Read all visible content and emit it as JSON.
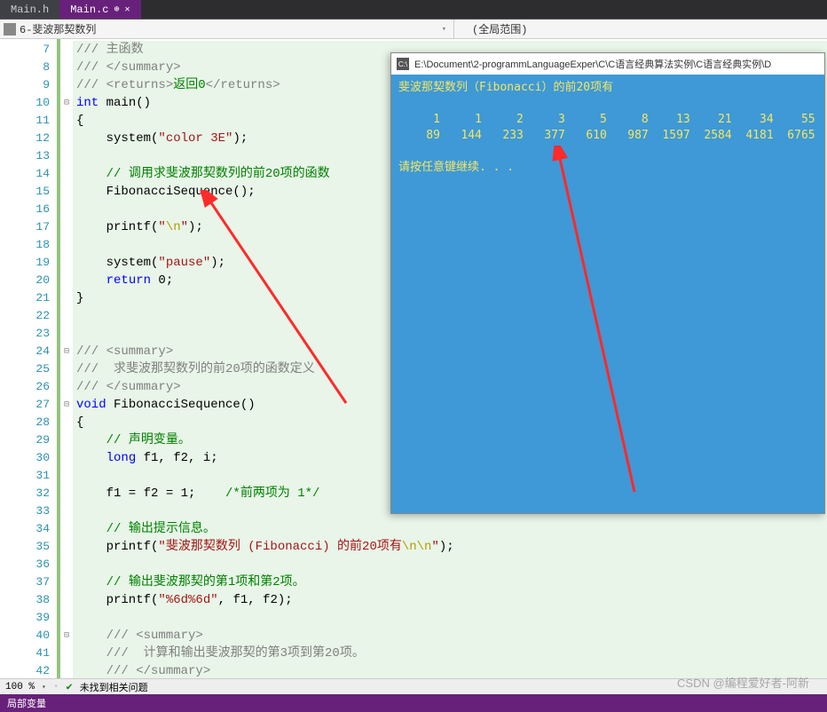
{
  "tabs": [
    {
      "label": "Main.h",
      "active": false
    },
    {
      "label": "Main.c",
      "active": true
    }
  ],
  "nav": {
    "project": "6-斐波那契数列",
    "scope": "(全局范围)"
  },
  "code": {
    "lines": [
      {
        "n": 7,
        "fold": "",
        "html": "<span class='doccomment'>/// 主函数</span>"
      },
      {
        "n": 8,
        "fold": "",
        "html": "<span class='doccomment'>/// &lt;/summary&gt;</span>"
      },
      {
        "n": 9,
        "fold": "",
        "html": "<span class='doccomment'>/// &lt;returns&gt;</span><span class='comment'>返回0</span><span class='doccomment'>&lt;/returns&gt;</span>"
      },
      {
        "n": 10,
        "fold": "⊟",
        "html": "<span class='kw'>int</span> main()"
      },
      {
        "n": 11,
        "fold": "",
        "html": "{"
      },
      {
        "n": 12,
        "fold": "",
        "html": "    system(<span class='string'>\"color 3E\"</span>);"
      },
      {
        "n": 13,
        "fold": "",
        "html": ""
      },
      {
        "n": 14,
        "fold": "",
        "html": "    <span class='comment'>// 调用求斐波那契数列的前20项的函数</span>"
      },
      {
        "n": 15,
        "fold": "",
        "html": "    FibonacciSequence();"
      },
      {
        "n": 16,
        "fold": "",
        "html": ""
      },
      {
        "n": 17,
        "fold": "",
        "html": "    printf(<span class='string'>\"</span><span class='escape'>\\n</span><span class='string'>\"</span>);"
      },
      {
        "n": 18,
        "fold": "",
        "html": ""
      },
      {
        "n": 19,
        "fold": "",
        "html": "    system(<span class='string'>\"pause\"</span>);"
      },
      {
        "n": 20,
        "fold": "",
        "html": "    <span class='kw'>return</span> 0;"
      },
      {
        "n": 21,
        "fold": "",
        "html": "}"
      },
      {
        "n": 22,
        "fold": "",
        "html": ""
      },
      {
        "n": 23,
        "fold": "",
        "html": ""
      },
      {
        "n": 24,
        "fold": "⊟",
        "html": "<span class='doccomment'>/// &lt;summary&gt;</span>"
      },
      {
        "n": 25,
        "fold": "",
        "html": "<span class='doccomment'>///  求斐波那契数列的前20项的函数定义</span>"
      },
      {
        "n": 26,
        "fold": "",
        "html": "<span class='doccomment'>/// &lt;/summary&gt;</span>"
      },
      {
        "n": 27,
        "fold": "⊟",
        "html": "<span class='kw'>void</span> FibonacciSequence()"
      },
      {
        "n": 28,
        "fold": "",
        "html": "{"
      },
      {
        "n": 29,
        "fold": "",
        "html": "    <span class='comment'>// 声明变量。</span>"
      },
      {
        "n": 30,
        "fold": "",
        "html": "    <span class='kw'>long</span> f1, f2, i;"
      },
      {
        "n": 31,
        "fold": "",
        "html": ""
      },
      {
        "n": 32,
        "fold": "",
        "html": "    f1 = f2 = 1;    <span class='comment'>/*前两项为 1*/</span>"
      },
      {
        "n": 33,
        "fold": "",
        "html": ""
      },
      {
        "n": 34,
        "fold": "",
        "html": "    <span class='comment'>// 输出提示信息。</span>"
      },
      {
        "n": 35,
        "fold": "",
        "html": "    printf(<span class='string'>\"斐波那契数列 (Fibonacci) 的前20项有</span><span class='escape'>\\n\\n</span><span class='string'>\"</span>);"
      },
      {
        "n": 36,
        "fold": "",
        "html": ""
      },
      {
        "n": 37,
        "fold": "",
        "html": "    <span class='comment'>// 输出斐波那契的第1项和第2项。</span>"
      },
      {
        "n": 38,
        "fold": "",
        "html": "    printf(<span class='string'>\"%6d%6d\"</span>, f1, f2);"
      },
      {
        "n": 39,
        "fold": "",
        "html": ""
      },
      {
        "n": 40,
        "fold": "⊟",
        "html": "    <span class='doccomment'>/// &lt;summary&gt;</span>"
      },
      {
        "n": 41,
        "fold": "",
        "html": "    <span class='doccomment'>///  计算和输出斐波那契的第3项到第20项。</span>"
      },
      {
        "n": 42,
        "fold": "",
        "html": "    <span class='doccomment'>/// &lt;/summary&gt;</span>"
      }
    ]
  },
  "console": {
    "title": "E:\\Document\\2-programmLanguageExper\\C\\C语言经典算法实例\\C语言经典实例\\D",
    "header": "斐波那契数列（Fibonacci）的前20项有",
    "row1": "     1     1     2     3     5     8    13    21    34    55",
    "row2": "    89   144   233   377   610   987  1597  2584  4181  6765",
    "prompt": "请按任意键继续. . ."
  },
  "zoom": {
    "level": "100 %",
    "status": "未找到相关问题"
  },
  "watermark": "CSDN @编程爱好者-阿新",
  "status": {
    "text": "局部变量"
  }
}
